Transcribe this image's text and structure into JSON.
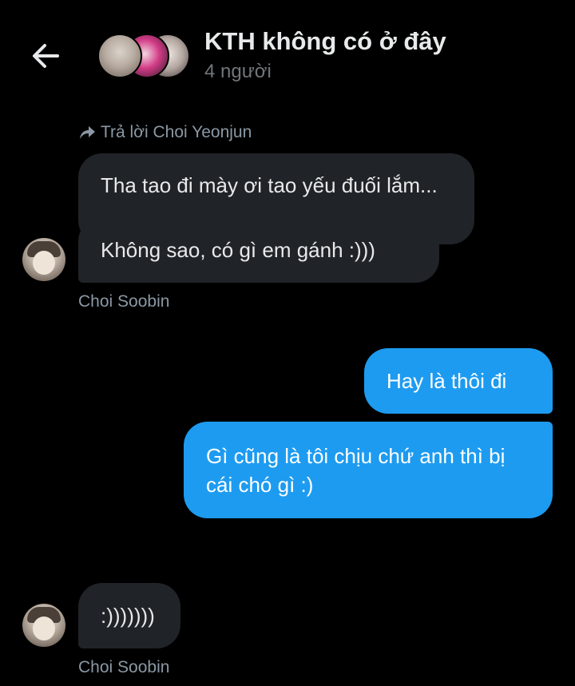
{
  "header": {
    "title": "KTH không có ở đây",
    "subtitle": "4 người",
    "back_icon": "arrow-left-icon"
  },
  "reply": {
    "text": "Trả lời Choi Yeonjun",
    "icon": "reply-arrow-icon"
  },
  "messages": [
    {
      "text": "Tha tao đi mày ơi tao yếu đuối lắm...",
      "direction": "incoming"
    },
    {
      "text": "Không sao, có gì em gánh :)))",
      "direction": "incoming"
    },
    {
      "text": "Hay là thôi đi",
      "direction": "outgoing"
    },
    {
      "text": "Gì cũng là tôi chịu chứ anh thì bị cái chó gì :)",
      "direction": "outgoing"
    },
    {
      "text": ":)))))))",
      "direction": "incoming"
    }
  ],
  "senders": [
    "Choi Soobin",
    "Choi Soobin"
  ],
  "colors": {
    "background": "#000000",
    "incoming_bubble": "#202327",
    "outgoing_bubble": "#1d9bf0",
    "secondary_text": "#8b98a5"
  }
}
